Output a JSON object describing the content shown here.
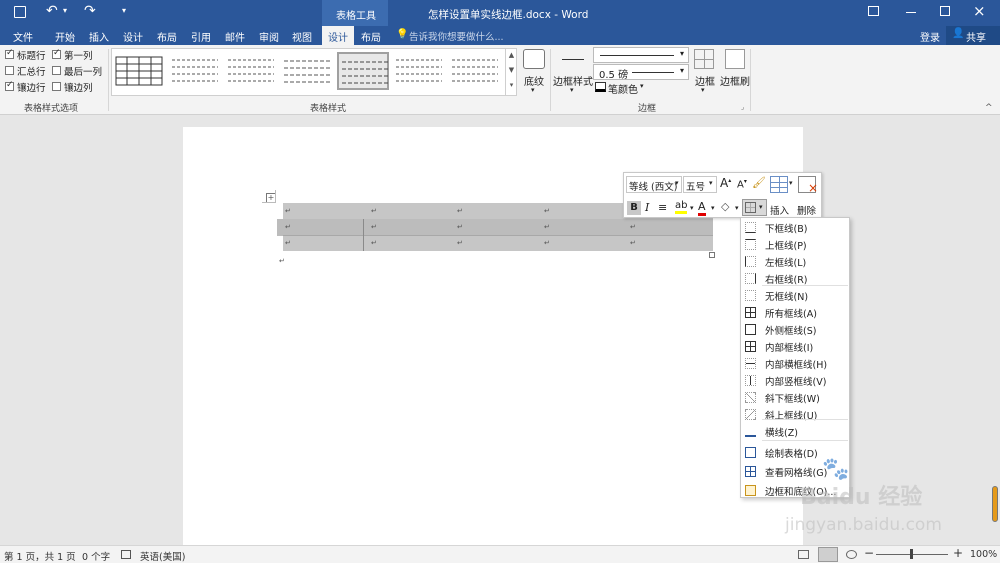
{
  "window": {
    "title": "怎样设置单实线边框.docx - Word",
    "context_group": "表格工具",
    "login": "登录",
    "share": "共享"
  },
  "tabs": [
    "文件",
    "开始",
    "插入",
    "设计",
    "布局",
    "引用",
    "邮件",
    "审阅",
    "视图",
    "设计",
    "布局"
  ],
  "tell_me": "告诉我你想要做什么...",
  "style_options": {
    "group_label": "表格样式选项",
    "items": [
      {
        "label": "标题行",
        "checked": true
      },
      {
        "label": "第一列",
        "checked": true
      },
      {
        "label": "汇总行",
        "checked": false
      },
      {
        "label": "最后一列",
        "checked": false
      },
      {
        "label": "镶边行",
        "checked": true
      },
      {
        "label": "镶边列",
        "checked": false
      }
    ]
  },
  "table_styles": {
    "group_label": "表格样式",
    "shading": "底纹"
  },
  "borders": {
    "group_label": "边框",
    "border_styles": "边框样式",
    "weight": "0.5 磅",
    "pen_color": "笔颜色",
    "borders_btn": "边框",
    "painter_btn": "边框刷"
  },
  "mini_toolbar": {
    "font": "等线 (西文)",
    "size": "五号",
    "insert": "插入",
    "delete": "删除"
  },
  "border_menu": [
    {
      "label": "下框线(B)",
      "icon": "bottom-border-icon"
    },
    {
      "label": "上框线(P)",
      "icon": "top-border-icon"
    },
    {
      "label": "左框线(L)",
      "icon": "left-border-icon"
    },
    {
      "label": "右框线(R)",
      "icon": "right-border-icon"
    },
    {
      "label": "无框线(N)",
      "icon": "no-border-icon"
    },
    {
      "label": "所有框线(A)",
      "icon": "all-borders-icon"
    },
    {
      "label": "外侧框线(S)",
      "icon": "outside-borders-icon"
    },
    {
      "label": "内部框线(I)",
      "icon": "inside-borders-icon"
    },
    {
      "label": "内部横框线(H)",
      "icon": "inside-horizontal-border-icon"
    },
    {
      "label": "内部竖框线(V)",
      "icon": "inside-vertical-border-icon"
    },
    {
      "label": "斜下框线(W)",
      "icon": "diagonal-down-border-icon"
    },
    {
      "label": "斜上框线(U)",
      "icon": "diagonal-up-border-icon"
    },
    {
      "label": "横线(Z)",
      "icon": "horizontal-line-icon"
    },
    {
      "label": "绘制表格(D)",
      "icon": "draw-table-icon"
    },
    {
      "label": "查看网格线(G)",
      "icon": "view-gridlines-icon"
    },
    {
      "label": "边框和底纹(O)...",
      "icon": "borders-shading-icon"
    }
  ],
  "status": {
    "page": "第 1 页，共 1 页",
    "words": "0 个字",
    "language": "英语(美国)",
    "zoom": "100%"
  },
  "watermark": {
    "brand": "Baidu 经验",
    "url": "jingyan.baidu.com"
  }
}
